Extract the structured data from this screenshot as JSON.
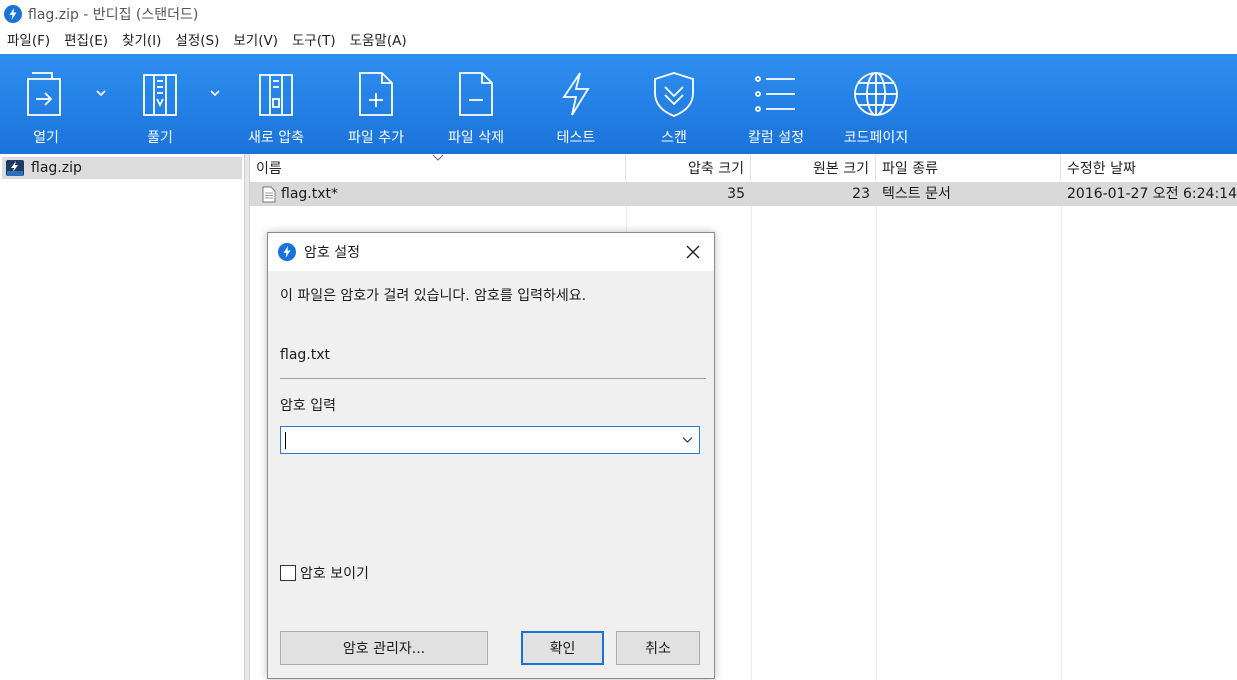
{
  "window": {
    "title": "flag.zip - 반디집 (스탠더드)"
  },
  "menu": [
    "파일(F)",
    "편집(E)",
    "찾기(I)",
    "설정(S)",
    "보기(V)",
    "도구(T)",
    "도움말(A)"
  ],
  "toolbar": {
    "open": "열기",
    "extract": "풀기",
    "new_archive": "새로 압축",
    "add_file": "파일 추가",
    "delete_file": "파일 삭제",
    "test": "테스트",
    "scan": "스캔",
    "columns": "칼럼 설정",
    "codepage": "코드페이지"
  },
  "tree": {
    "root": "flag.zip"
  },
  "list": {
    "columns": {
      "name": "이름",
      "packed": "압축 크기",
      "original": "원본 크기",
      "type": "파일 종류",
      "modified": "수정한 날짜"
    },
    "rows": [
      {
        "name": "flag.txt*",
        "packed": "35",
        "original": "23",
        "type": "텍스트 문서",
        "modified": "2016-01-27 오전 6:24:14"
      }
    ]
  },
  "dialog": {
    "title": "암호 설정",
    "message": "이 파일은 암호가 걸려 있습니다. 암호를 입력하세요.",
    "file": "flag.txt",
    "password_label": "암호 입력",
    "password_value": "",
    "show_password": "암호 보이기",
    "manager_button": "암호 관리자...",
    "ok_button": "확인",
    "cancel_button": "취소"
  },
  "colors": {
    "toolbar": "#1a73d9",
    "accent": "#2a7ad4",
    "selection": "#d9d9d9"
  }
}
